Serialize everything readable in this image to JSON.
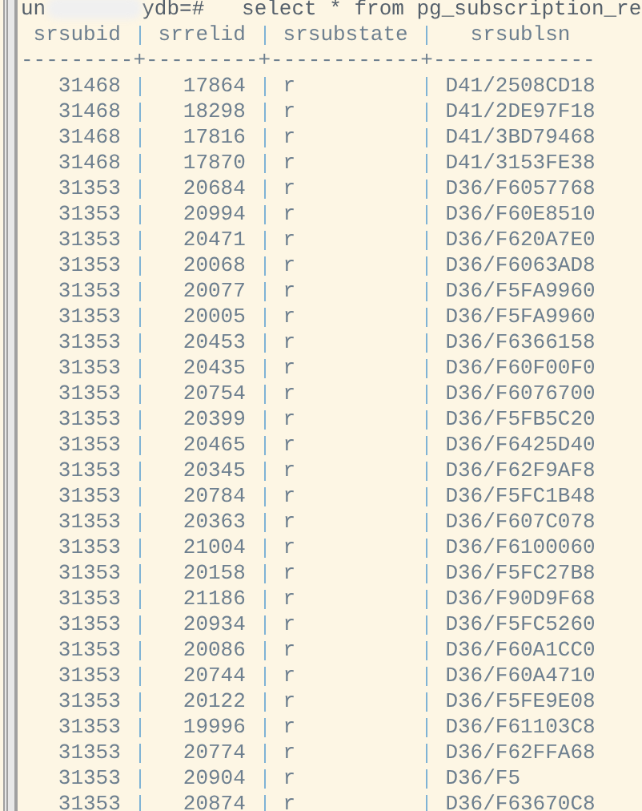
{
  "prompt": {
    "prefix": "un",
    "suffix": "ydb=#",
    "command": "select * from pg_subscription_re"
  },
  "table": {
    "columns": [
      "srsubid",
      "srrelid",
      "srsubstate",
      "srsublsn"
    ],
    "separator": "---------+---------+------------+-------------",
    "rows": [
      [
        "31468",
        "17864",
        "r",
        "D41/2508CD18"
      ],
      [
        "31468",
        "18298",
        "r",
        "D41/2DE97F18"
      ],
      [
        "31468",
        "17816",
        "r",
        "D41/3BD79468"
      ],
      [
        "31468",
        "17870",
        "r",
        "D41/3153FE38"
      ],
      [
        "31353",
        "20684",
        "r",
        "D36/F6057768"
      ],
      [
        "31353",
        "20994",
        "r",
        "D36/F60E8510"
      ],
      [
        "31353",
        "20471",
        "r",
        "D36/F620A7E0"
      ],
      [
        "31353",
        "20068",
        "r",
        "D36/F6063AD8"
      ],
      [
        "31353",
        "20077",
        "r",
        "D36/F5FA9960"
      ],
      [
        "31353",
        "20005",
        "r",
        "D36/F5FA9960"
      ],
      [
        "31353",
        "20453",
        "r",
        "D36/F6366158"
      ],
      [
        "31353",
        "20435",
        "r",
        "D36/F60F00F0"
      ],
      [
        "31353",
        "20754",
        "r",
        "D36/F6076700"
      ],
      [
        "31353",
        "20399",
        "r",
        "D36/F5FB5C20"
      ],
      [
        "31353",
        "20465",
        "r",
        "D36/F6425D40"
      ],
      [
        "31353",
        "20345",
        "r",
        "D36/F62F9AF8"
      ],
      [
        "31353",
        "20784",
        "r",
        "D36/F5FC1B48"
      ],
      [
        "31353",
        "20363",
        "r",
        "D36/F607C078"
      ],
      [
        "31353",
        "21004",
        "r",
        "D36/F6100060"
      ],
      [
        "31353",
        "20158",
        "r",
        "D36/F5FC27B8"
      ],
      [
        "31353",
        "21186",
        "r",
        "D36/F90D9F68"
      ],
      [
        "31353",
        "20934",
        "r",
        "D36/F5FC5260"
      ],
      [
        "31353",
        "20086",
        "r",
        "D36/F60A1CC0"
      ],
      [
        "31353",
        "20744",
        "r",
        "D36/F60A4710"
      ],
      [
        "31353",
        "20122",
        "r",
        "D36/F5FE9E08"
      ],
      [
        "31353",
        "19996",
        "r",
        "D36/F61103C8"
      ],
      [
        "31353",
        "20774",
        "r",
        "D36/F62FFA68"
      ],
      [
        "31353",
        "20904",
        "r",
        "D36/F5"
      ],
      [
        "31353",
        "20874",
        "r",
        "D36/F63670C8"
      ]
    ]
  }
}
